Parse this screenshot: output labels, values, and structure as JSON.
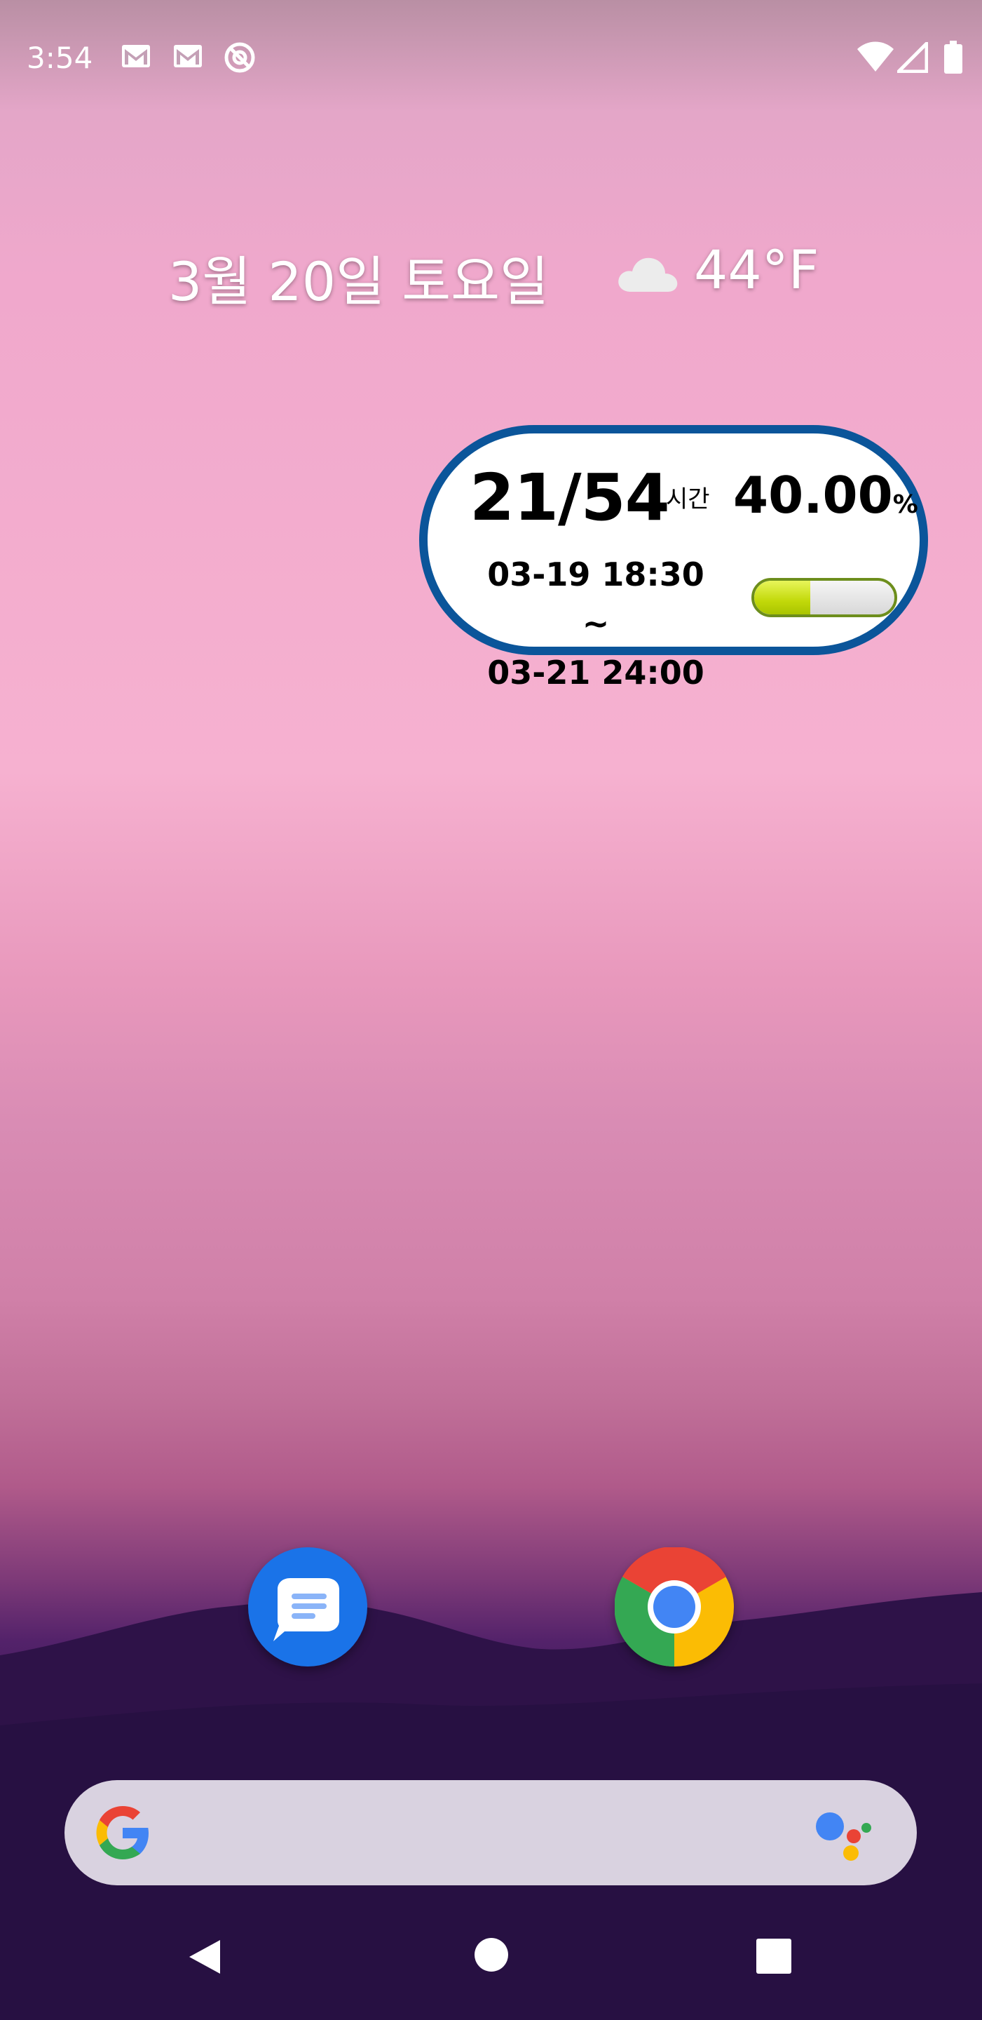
{
  "status_bar": {
    "time": "3:54",
    "notification_icons": [
      "gmail-icon",
      "gmail-icon",
      "no-sim-app-icon"
    ],
    "system_icons": [
      "wifi-icon",
      "cellular-signal-icon",
      "battery-icon"
    ]
  },
  "at_a_glance": {
    "date": "3월 20일 토요일",
    "weather_icon": "cloudy-icon",
    "temperature": "44°F"
  },
  "widget": {
    "hours": "21/54",
    "unit": "시간",
    "percent": "40.00",
    "percent_sign": "%",
    "range_start": "03-19 18:30 ~",
    "range_end": "03-21 24:00",
    "progress": 0.4,
    "border_color": "#0b559a",
    "bar_color": "#c2d90a"
  },
  "dock": {
    "apps": [
      {
        "name": "Messages",
        "icon": "messages-icon"
      },
      {
        "name": "Chrome",
        "icon": "chrome-icon"
      }
    ]
  },
  "search_bar": {
    "logo": "google-g-icon",
    "assistant": "google-assistant-icon"
  },
  "nav_bar": {
    "buttons": [
      "back-icon",
      "home-icon",
      "recents-icon"
    ]
  }
}
